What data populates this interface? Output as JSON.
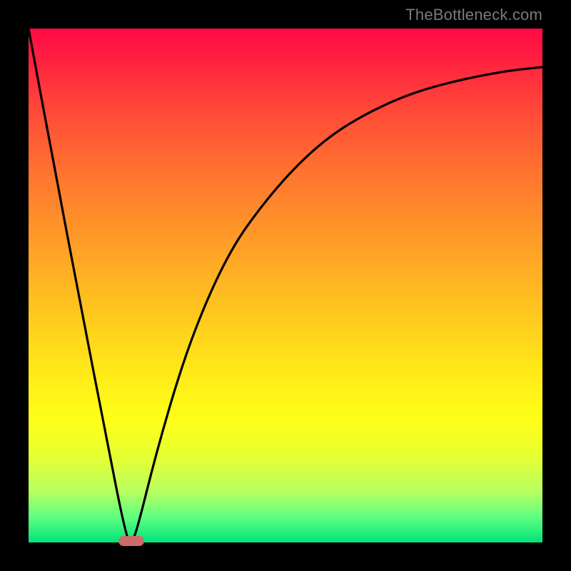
{
  "watermark": "TheBottleneck.com",
  "colors": {
    "frame_bg": "#000000",
    "marker": "#cf6a6a",
    "curve": "#000000",
    "watermark": "#7a7a7a"
  },
  "chart_data": {
    "type": "line",
    "title": "",
    "xlabel": "",
    "ylabel": "",
    "xlim": [
      0,
      100
    ],
    "ylim": [
      0,
      100
    ],
    "grid": false,
    "legend": false,
    "series": [
      {
        "name": "curve",
        "x": [
          0,
          5,
          10,
          15,
          19,
          20,
          21,
          25,
          30,
          35,
          40,
          45,
          50,
          55,
          60,
          65,
          70,
          75,
          80,
          85,
          90,
          95,
          100
        ],
        "y": [
          100,
          73,
          47,
          21,
          1,
          0,
          2,
          18,
          35,
          48,
          58,
          65,
          71,
          76,
          80,
          83,
          85.5,
          87.5,
          89,
          90.2,
          91.2,
          92,
          92.5
        ]
      }
    ],
    "marker": {
      "x": 20,
      "y": 0,
      "label": ""
    },
    "background_gradient": [
      "#ff0a45",
      "#ffff18",
      "#00e37a"
    ]
  }
}
